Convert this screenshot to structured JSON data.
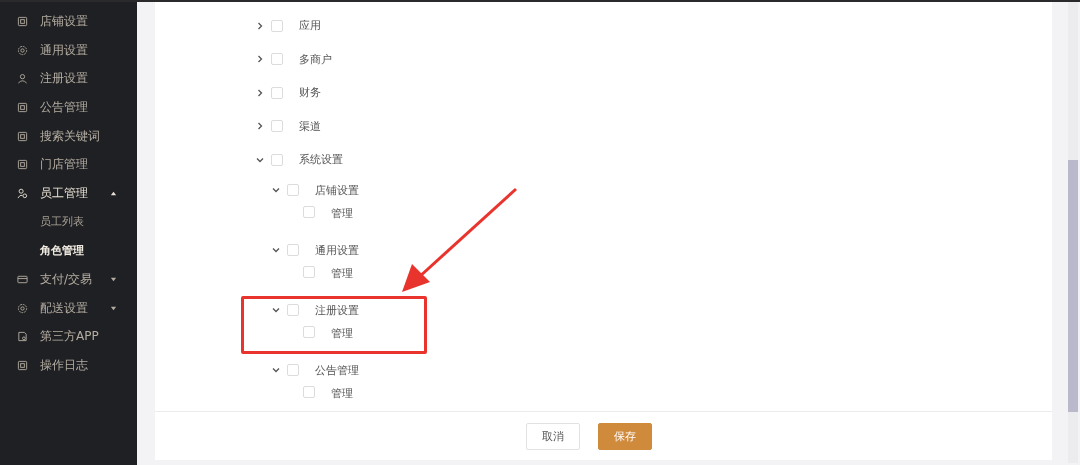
{
  "sidebar": {
    "items": [
      {
        "label": "店铺设置"
      },
      {
        "label": "通用设置"
      },
      {
        "label": "注册设置"
      },
      {
        "label": "公告管理"
      },
      {
        "label": "搜索关键词"
      },
      {
        "label": "门店管理"
      },
      {
        "label": "员工管理",
        "expanded": true,
        "children": [
          {
            "label": "员工列表",
            "selected": false
          },
          {
            "label": "角色管理",
            "selected": true
          }
        ]
      },
      {
        "label": "支付/交易",
        "expanded": false
      },
      {
        "label": "配送设置",
        "expanded": false
      },
      {
        "label": "第三方APP"
      },
      {
        "label": "操作日志"
      }
    ]
  },
  "permission_tree": [
    {
      "label": "应用",
      "checked": false,
      "expanded": false
    },
    {
      "label": "多商户",
      "checked": false,
      "expanded": false
    },
    {
      "label": "财务",
      "checked": false,
      "expanded": false
    },
    {
      "label": "渠道",
      "checked": false,
      "expanded": false
    },
    {
      "label": "系统设置",
      "checked": false,
      "expanded": true,
      "children": [
        {
          "label": "店铺设置",
          "checked": false,
          "expanded": true,
          "children": [
            {
              "label": "管理",
              "checked": false
            }
          ]
        },
        {
          "label": "通用设置",
          "checked": false,
          "expanded": true,
          "children": [
            {
              "label": "管理",
              "checked": false
            }
          ]
        },
        {
          "label": "注册设置",
          "checked": false,
          "expanded": true,
          "children": [
            {
              "label": "管理",
              "checked": false
            }
          ]
        },
        {
          "label": "公告管理",
          "checked": false,
          "expanded": true,
          "children": [
            {
              "label": "管理",
              "checked": false
            }
          ]
        }
      ]
    }
  ],
  "buttons": [
    "取消",
    "保存"
  ]
}
